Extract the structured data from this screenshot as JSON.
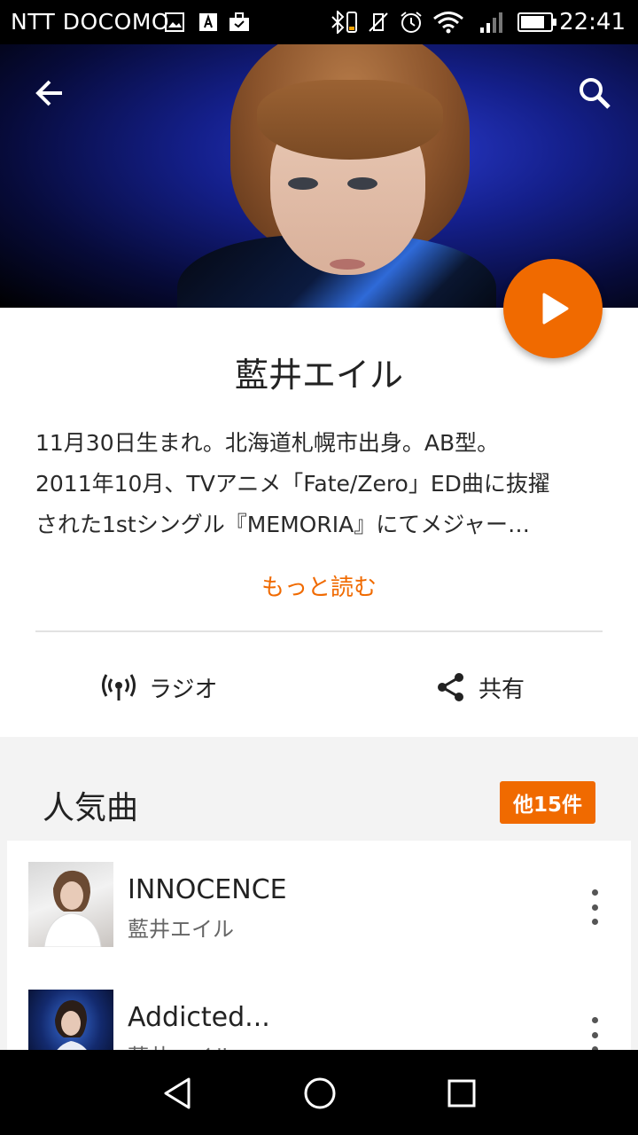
{
  "status_bar": {
    "carrier": "NTT DOCOMO",
    "time": "22:41",
    "icons": [
      "image-icon",
      "font-icon",
      "briefcase-icon",
      "bluetooth-icon",
      "vibrate-off-icon",
      "alarm-icon",
      "wifi-icon",
      "signal-icon",
      "battery-icon"
    ]
  },
  "header": {
    "back_icon": "arrow-left-icon",
    "search_icon": "search-icon"
  },
  "artist": {
    "name": "藍井エイル",
    "bio_lines": [
      "11月30日生まれ。北海道札幌市出身。AB型。",
      "2011年10月、TVアニメ「Fate/Zero」ED曲に抜擢",
      "された1stシングル『MEMORIA』にてメジャー…"
    ],
    "more_label": "もっと読む"
  },
  "actions": {
    "radio_label": "ラジオ",
    "share_label": "共有"
  },
  "popular": {
    "title": "人気曲",
    "more_badge": "他15件",
    "songs": [
      {
        "title": "INNOCENCE",
        "artist": "藍井エイル"
      },
      {
        "title": "Addicted...",
        "artist": "藍井エイル"
      }
    ]
  },
  "colors": {
    "accent": "#f06a00",
    "background": "#f3f3f3"
  }
}
